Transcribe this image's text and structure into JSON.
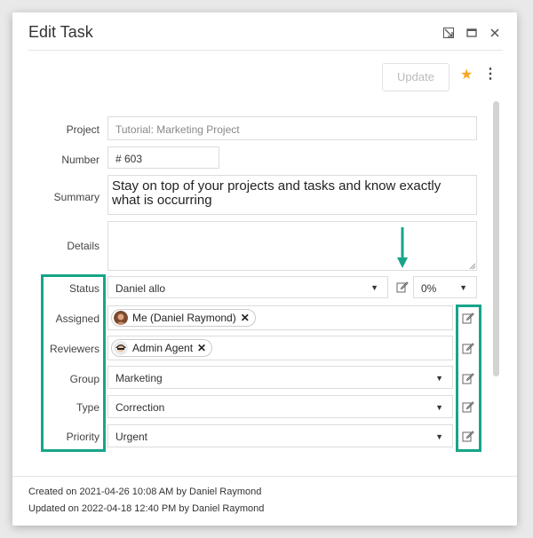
{
  "dialog": {
    "title": "Edit Task",
    "controls": [
      "minimize-icon",
      "maximize-icon",
      "close-icon"
    ]
  },
  "toolbar": {
    "update_label": "Update",
    "star_glyph": "★",
    "more_glyph": "⋮"
  },
  "form": {
    "project": {
      "label": "Project",
      "value": "Tutorial: Marketing Project"
    },
    "number": {
      "label": "Number",
      "value": "# 603"
    },
    "summary": {
      "label": "Summary",
      "value": "Stay on top of your projects and tasks and know exactly what is occurring"
    },
    "details": {
      "label": "Details",
      "value": ""
    },
    "status": {
      "label": "Status",
      "value": "Daniel allo",
      "progress": "0%"
    },
    "assigned": {
      "label": "Assigned",
      "chips": [
        {
          "name": "Me (Daniel Raymond)"
        }
      ]
    },
    "reviewers": {
      "label": "Reviewers",
      "chips": [
        {
          "name": "Admin Agent"
        }
      ]
    },
    "group": {
      "label": "Group",
      "value": "Marketing"
    },
    "type": {
      "label": "Type",
      "value": "Correction"
    },
    "priority": {
      "label": "Priority",
      "value": "Urgent"
    }
  },
  "footer": {
    "created": "Created on 2021-04-26 10:08 AM by Daniel Raymond",
    "updated": "Updated on 2022-04-18 12:40 PM by Daniel Raymond"
  },
  "colors": {
    "highlight": "#17a589",
    "star": "#f6a623"
  }
}
